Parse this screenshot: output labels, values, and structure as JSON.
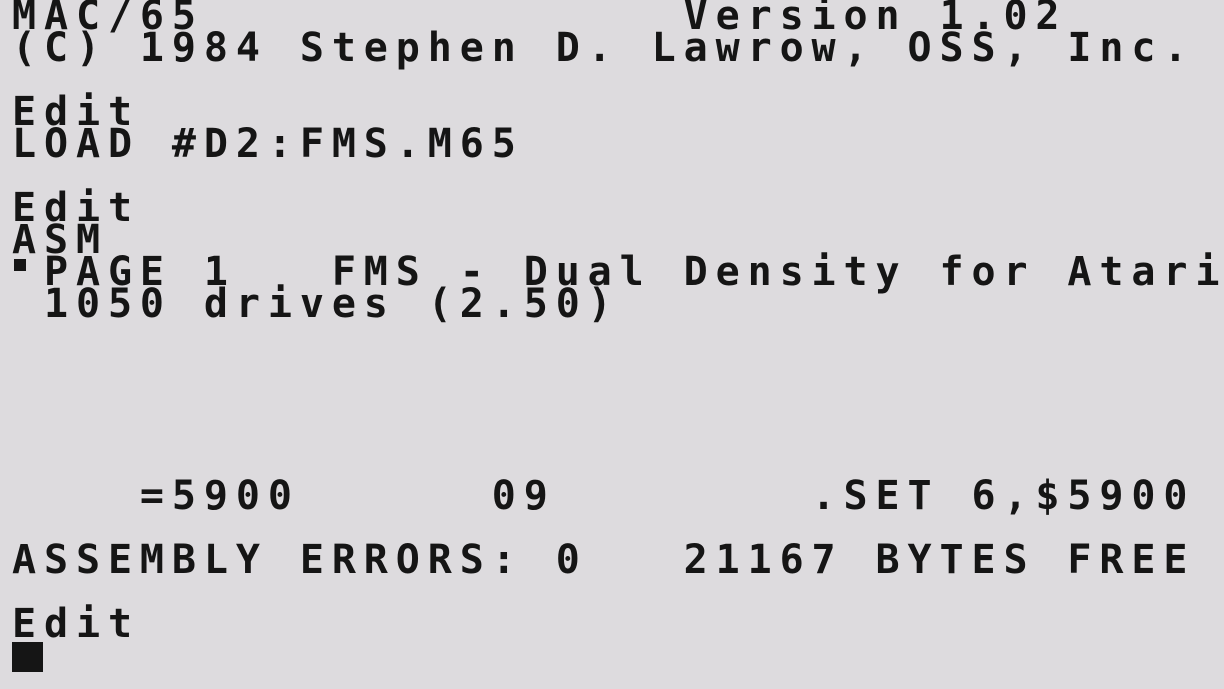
{
  "screen": {
    "lines": [
      "MAC/65               Version 1.02",
      "(C) 1984 Stephen D. Lawrow, OSS, Inc.",
      "",
      "Edit",
      "LOAD #D2:FMS.M65",
      "",
      "Edit",
      "ASM",
      " PAGE 1   FMS - Dual Density for Atari",
      " 1050 drives (2.50)",
      "",
      "",
      "",
      "",
      "",
      "    =5900      09        .SET 6,$5900",
      "",
      "ASSEMBLY ERRORS: 0   21167 BYTES FREE",
      "",
      "Edit",
      ""
    ]
  },
  "colors": {
    "background": "#dddbde",
    "foreground": "#151515"
  }
}
